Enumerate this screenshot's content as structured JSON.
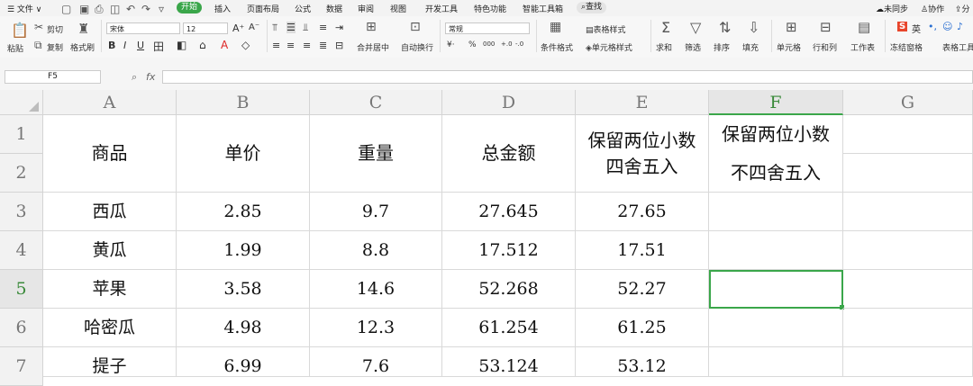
{
  "menu": {
    "file": "☰ 文件 ∨",
    "tabs": [
      "开始",
      "插入",
      "页面布局",
      "公式",
      "数据",
      "审阅",
      "视图",
      "开发工具",
      "特色功能",
      "智能工具箱"
    ],
    "search": "查找",
    "right": [
      "未同步",
      "协作",
      "分"
    ]
  },
  "ribbon": {
    "paste": "粘贴",
    "cut": "剪切",
    "copy": "复制",
    "format_painter": "格式刷",
    "font_name": "宋体",
    "font_size": "12",
    "merge_center": "合并居中",
    "wrap_text": "自动换行",
    "number_format": "常规",
    "table_style": "表格样式",
    "cond_format": "条件格式",
    "cell_style": "单元格样式",
    "sum": "求和",
    "filter": "筛选",
    "sort": "排序",
    "fill": "填充",
    "cells": "单元格",
    "rows_cols": "行和列",
    "worksheet": "工作表",
    "freeze": "冻结窗格",
    "table_tools": "表格工具",
    "ime": "英"
  },
  "formula_bar": {
    "cell_ref": "F5",
    "fx": "fx",
    "value": ""
  },
  "sheet": {
    "columns": [
      "A",
      "B",
      "C",
      "D",
      "E",
      "F",
      "G"
    ],
    "rows": [
      "1",
      "2",
      "3",
      "4",
      "5",
      "6",
      "7"
    ],
    "header": {
      "a": "商品",
      "b": "单价",
      "c": "重量",
      "d": "总金额",
      "e": "保留两位小数\n四舍五入",
      "f1": "保留两位小数",
      "f2": "不四舍五入"
    },
    "data": [
      {
        "a": "西瓜",
        "b": "2.85",
        "c": "9.7",
        "d": "27.645",
        "e": "27.65"
      },
      {
        "a": "黄瓜",
        "b": "1.99",
        "c": "8.8",
        "d": "17.512",
        "e": "17.51"
      },
      {
        "a": "苹果",
        "b": "3.58",
        "c": "14.6",
        "d": "52.268",
        "e": "52.27"
      },
      {
        "a": "哈密瓜",
        "b": "4.98",
        "c": "12.3",
        "d": "61.254",
        "e": "61.25"
      },
      {
        "a": "提子",
        "b": "6.99",
        "c": "7.6",
        "d": "53.124",
        "e": "53.12"
      }
    ],
    "selected_cell": "F5",
    "accent_color": "#3aa64a"
  }
}
